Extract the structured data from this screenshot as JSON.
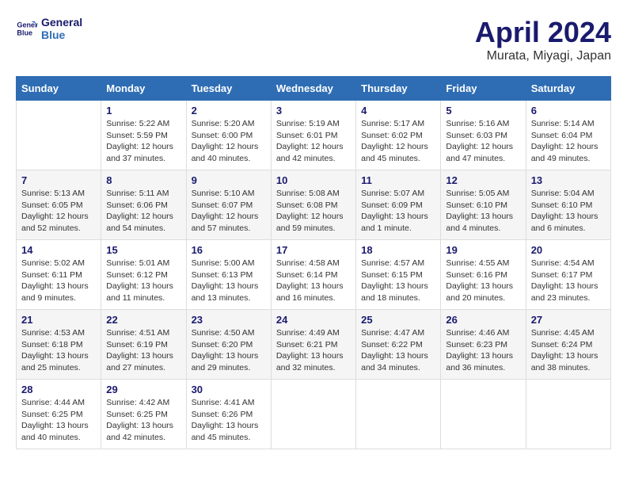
{
  "header": {
    "logo_line1": "General",
    "logo_line2": "Blue",
    "month": "April 2024",
    "location": "Murata, Miyagi, Japan"
  },
  "days_of_week": [
    "Sunday",
    "Monday",
    "Tuesday",
    "Wednesday",
    "Thursday",
    "Friday",
    "Saturday"
  ],
  "weeks": [
    [
      {
        "day": "",
        "info": ""
      },
      {
        "day": "1",
        "info": "Sunrise: 5:22 AM\nSunset: 5:59 PM\nDaylight: 12 hours\nand 37 minutes."
      },
      {
        "day": "2",
        "info": "Sunrise: 5:20 AM\nSunset: 6:00 PM\nDaylight: 12 hours\nand 40 minutes."
      },
      {
        "day": "3",
        "info": "Sunrise: 5:19 AM\nSunset: 6:01 PM\nDaylight: 12 hours\nand 42 minutes."
      },
      {
        "day": "4",
        "info": "Sunrise: 5:17 AM\nSunset: 6:02 PM\nDaylight: 12 hours\nand 45 minutes."
      },
      {
        "day": "5",
        "info": "Sunrise: 5:16 AM\nSunset: 6:03 PM\nDaylight: 12 hours\nand 47 minutes."
      },
      {
        "day": "6",
        "info": "Sunrise: 5:14 AM\nSunset: 6:04 PM\nDaylight: 12 hours\nand 49 minutes."
      }
    ],
    [
      {
        "day": "7",
        "info": "Sunrise: 5:13 AM\nSunset: 6:05 PM\nDaylight: 12 hours\nand 52 minutes."
      },
      {
        "day": "8",
        "info": "Sunrise: 5:11 AM\nSunset: 6:06 PM\nDaylight: 12 hours\nand 54 minutes."
      },
      {
        "day": "9",
        "info": "Sunrise: 5:10 AM\nSunset: 6:07 PM\nDaylight: 12 hours\nand 57 minutes."
      },
      {
        "day": "10",
        "info": "Sunrise: 5:08 AM\nSunset: 6:08 PM\nDaylight: 12 hours\nand 59 minutes."
      },
      {
        "day": "11",
        "info": "Sunrise: 5:07 AM\nSunset: 6:09 PM\nDaylight: 13 hours\nand 1 minute."
      },
      {
        "day": "12",
        "info": "Sunrise: 5:05 AM\nSunset: 6:10 PM\nDaylight: 13 hours\nand 4 minutes."
      },
      {
        "day": "13",
        "info": "Sunrise: 5:04 AM\nSunset: 6:10 PM\nDaylight: 13 hours\nand 6 minutes."
      }
    ],
    [
      {
        "day": "14",
        "info": "Sunrise: 5:02 AM\nSunset: 6:11 PM\nDaylight: 13 hours\nand 9 minutes."
      },
      {
        "day": "15",
        "info": "Sunrise: 5:01 AM\nSunset: 6:12 PM\nDaylight: 13 hours\nand 11 minutes."
      },
      {
        "day": "16",
        "info": "Sunrise: 5:00 AM\nSunset: 6:13 PM\nDaylight: 13 hours\nand 13 minutes."
      },
      {
        "day": "17",
        "info": "Sunrise: 4:58 AM\nSunset: 6:14 PM\nDaylight: 13 hours\nand 16 minutes."
      },
      {
        "day": "18",
        "info": "Sunrise: 4:57 AM\nSunset: 6:15 PM\nDaylight: 13 hours\nand 18 minutes."
      },
      {
        "day": "19",
        "info": "Sunrise: 4:55 AM\nSunset: 6:16 PM\nDaylight: 13 hours\nand 20 minutes."
      },
      {
        "day": "20",
        "info": "Sunrise: 4:54 AM\nSunset: 6:17 PM\nDaylight: 13 hours\nand 23 minutes."
      }
    ],
    [
      {
        "day": "21",
        "info": "Sunrise: 4:53 AM\nSunset: 6:18 PM\nDaylight: 13 hours\nand 25 minutes."
      },
      {
        "day": "22",
        "info": "Sunrise: 4:51 AM\nSunset: 6:19 PM\nDaylight: 13 hours\nand 27 minutes."
      },
      {
        "day": "23",
        "info": "Sunrise: 4:50 AM\nSunset: 6:20 PM\nDaylight: 13 hours\nand 29 minutes."
      },
      {
        "day": "24",
        "info": "Sunrise: 4:49 AM\nSunset: 6:21 PM\nDaylight: 13 hours\nand 32 minutes."
      },
      {
        "day": "25",
        "info": "Sunrise: 4:47 AM\nSunset: 6:22 PM\nDaylight: 13 hours\nand 34 minutes."
      },
      {
        "day": "26",
        "info": "Sunrise: 4:46 AM\nSunset: 6:23 PM\nDaylight: 13 hours\nand 36 minutes."
      },
      {
        "day": "27",
        "info": "Sunrise: 4:45 AM\nSunset: 6:24 PM\nDaylight: 13 hours\nand 38 minutes."
      }
    ],
    [
      {
        "day": "28",
        "info": "Sunrise: 4:44 AM\nSunset: 6:25 PM\nDaylight: 13 hours\nand 40 minutes."
      },
      {
        "day": "29",
        "info": "Sunrise: 4:42 AM\nSunset: 6:25 PM\nDaylight: 13 hours\nand 42 minutes."
      },
      {
        "day": "30",
        "info": "Sunrise: 4:41 AM\nSunset: 6:26 PM\nDaylight: 13 hours\nand 45 minutes."
      },
      {
        "day": "",
        "info": ""
      },
      {
        "day": "",
        "info": ""
      },
      {
        "day": "",
        "info": ""
      },
      {
        "day": "",
        "info": ""
      }
    ]
  ]
}
